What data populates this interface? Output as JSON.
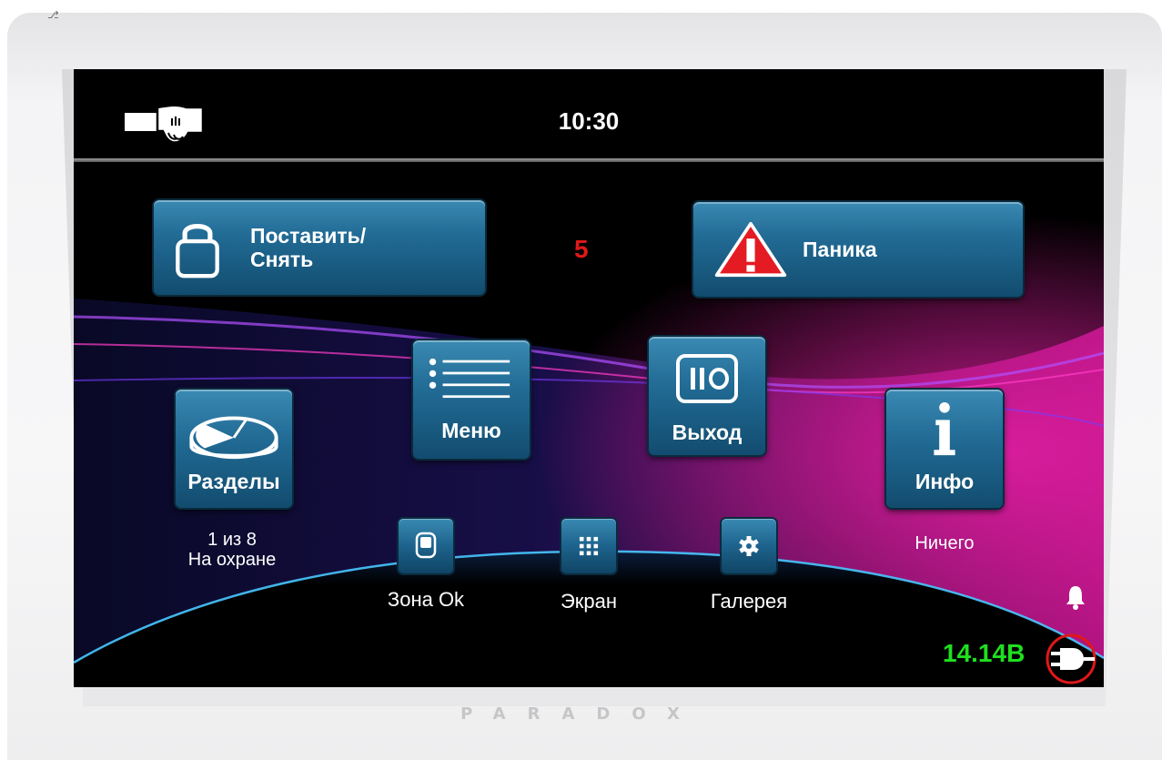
{
  "window": {
    "corner_glyph": "⎇"
  },
  "header": {
    "time": "10:30"
  },
  "arm_button": {
    "label_line1": "Поставить/",
    "label_line2": "Снять"
  },
  "alarm_count": "5",
  "panic_button": {
    "label": "Паника"
  },
  "tiles": {
    "partitions": {
      "label": "Разделы",
      "status_line1": "1 из 8",
      "status_line2": "На охране"
    },
    "menu": {
      "label": "Меню"
    },
    "exit": {
      "label": "Выход"
    },
    "info": {
      "label": "Инфо",
      "status": "Ничего"
    }
  },
  "small_buttons": {
    "zone": {
      "label": "Зона Ok"
    },
    "screen": {
      "label": "Экран"
    },
    "gallery": {
      "label": "Галерея"
    }
  },
  "power": {
    "voltage": "14.14В"
  },
  "brand": "PARADOX",
  "colors": {
    "button_blue": "#226c96",
    "alarm_red": "#e01818",
    "voltage_green": "#1fe01f",
    "wave_magenta": "#c0148c",
    "wave_cyan": "#49c8ff"
  }
}
